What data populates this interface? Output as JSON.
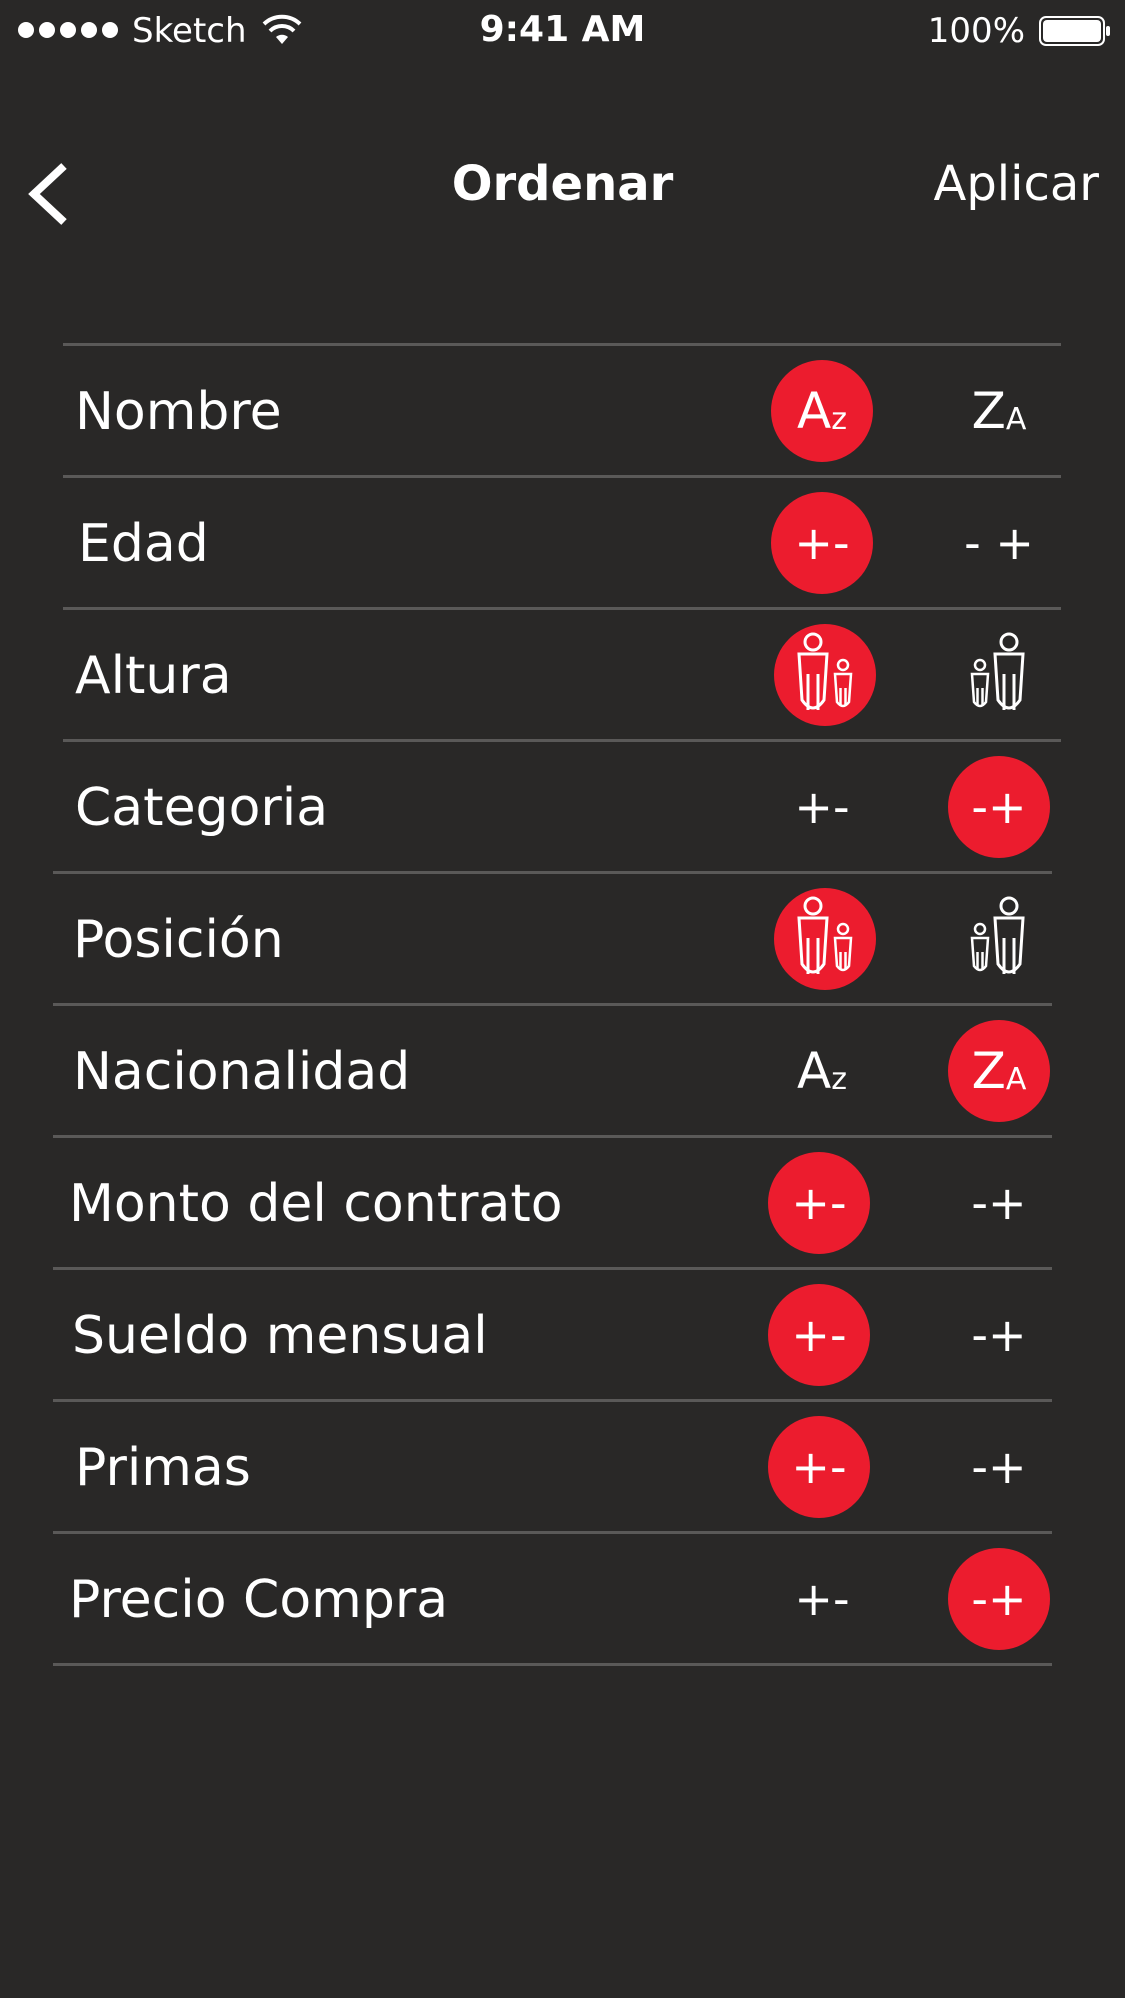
{
  "status_bar": {
    "carrier": "Sketch",
    "time": "9:41 AM",
    "battery_percent": "100%"
  },
  "nav": {
    "title": "Ordenar",
    "apply_label": "Aplicar"
  },
  "colors": {
    "background": "#292827",
    "accent": "#ec1c2e",
    "divider": "#5a5958",
    "text": "#ffffff"
  },
  "rows": [
    {
      "label": "Nombre",
      "options": [
        {
          "type": "text",
          "main": "A",
          "sub": "z",
          "selected": true
        },
        {
          "type": "text",
          "main": "Z",
          "sub": "A",
          "selected": false
        }
      ]
    },
    {
      "label": "Edad",
      "options": [
        {
          "type": "text",
          "text": "+-",
          "selected": true
        },
        {
          "type": "text",
          "text": "- +",
          "selected": false
        }
      ]
    },
    {
      "label": "Altura",
      "options": [
        {
          "type": "icon",
          "icon": "tall-short-people-icon",
          "selected": true
        },
        {
          "type": "icon",
          "icon": "short-tall-people-icon",
          "selected": false
        }
      ]
    },
    {
      "label": "Categoria",
      "options": [
        {
          "type": "text",
          "text": "+-",
          "selected": false
        },
        {
          "type": "text",
          "text": "-+",
          "selected": true
        }
      ]
    },
    {
      "label": "Posición",
      "options": [
        {
          "type": "icon",
          "icon": "tall-short-people-icon",
          "selected": true
        },
        {
          "type": "icon",
          "icon": "short-tall-people-icon",
          "selected": false
        }
      ]
    },
    {
      "label": "Nacionalidad",
      "options": [
        {
          "type": "text",
          "main": "A",
          "sub": "z",
          "selected": false
        },
        {
          "type": "text",
          "main": "Z",
          "sub": "A",
          "selected": true
        }
      ]
    },
    {
      "label": "Monto del contrato",
      "options": [
        {
          "type": "text",
          "text": "+-",
          "selected": true
        },
        {
          "type": "text",
          "text": "-+",
          "selected": false
        }
      ]
    },
    {
      "label": "Sueldo mensual",
      "options": [
        {
          "type": "text",
          "text": "+-",
          "selected": true
        },
        {
          "type": "text",
          "text": "-+",
          "selected": false
        }
      ]
    },
    {
      "label": "Primas",
      "options": [
        {
          "type": "text",
          "text": "+-",
          "selected": true
        },
        {
          "type": "text",
          "text": "-+",
          "selected": false
        }
      ]
    },
    {
      "label": "Precio Compra",
      "options": [
        {
          "type": "text",
          "text": "+-",
          "selected": false
        },
        {
          "type": "text",
          "text": "-+",
          "selected": true
        }
      ]
    }
  ]
}
